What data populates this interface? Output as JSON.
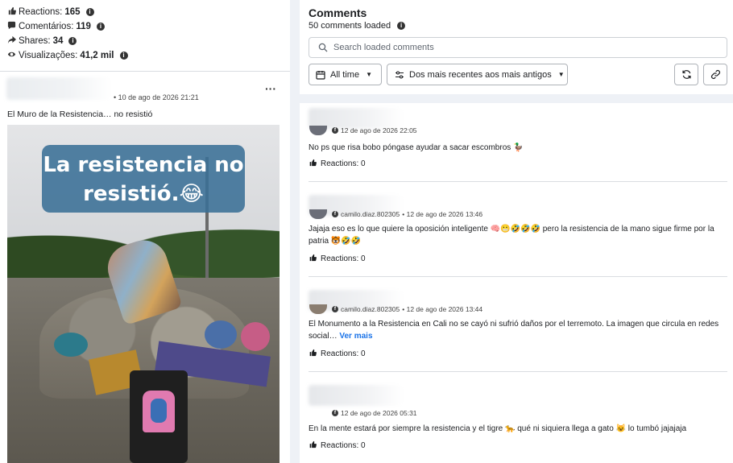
{
  "post_stats": {
    "reactions_label": "Reactions:",
    "reactions_value": "165",
    "comments_label": "Comentários:",
    "comments_value": "119",
    "shares_label": "Shares:",
    "shares_value": "34",
    "views_label": "Visualizações:",
    "views_value": "41,2 mil",
    "info_glyph": "i"
  },
  "post": {
    "date": "• 10 de ago de 2026 21:21",
    "text": "El Muro de la Resistencia… no resistió",
    "more_glyph": "···",
    "image_caption": "La resistencia no resistió.😂"
  },
  "comments_panel": {
    "title": "Comments",
    "loaded": "50 comments loaded",
    "search_placeholder": "Search loaded comments",
    "filter_label": "All time",
    "sort_label": "Dos mais recentes aos mais antigos",
    "caret": "▼",
    "info_glyph": "i"
  },
  "comments": [
    {
      "username": "",
      "date": "12 de ago de 2026 22:05",
      "text": "No ps que risa bobo póngase ayudar a sacar escombros 🦆",
      "more": "",
      "reactions": "Reactions: 0"
    },
    {
      "username": "camilo.diaz.802305",
      "date": "• 12 de ago de 2026 13:46",
      "text": "Jajaja eso es lo que quiere la oposición inteligente 🧠😬🤣🤣🤣 pero la resistencia de la mano sigue firme por la patria 🐯🤣🤣",
      "more": "",
      "reactions": "Reactions: 0"
    },
    {
      "username": "camilo.diaz.802305",
      "date": "• 12 de ago de 2026 13:44",
      "text": "El Monumento a la Resistencia en Cali no se cayó ni sufrió daños por el terremoto. La imagen que circula en redes social…",
      "more": "Ver mais",
      "reactions": "Reactions: 0"
    },
    {
      "username": "",
      "date": "12 de ago de 2026 05:31",
      "text": "En la mente estará por siempre la resistencia y el tigre 🐆 qué ni siquiera llega a gato 😺 lo tumbó jajajaja",
      "more": "",
      "reactions": "Reactions: 0"
    }
  ],
  "icons": {
    "reactions": "reactions-icon",
    "comments": "comment-bubble-icon",
    "shares": "share-arrow-icon",
    "views": "eye-icon",
    "search": "search-icon",
    "calendar": "calendar-icon",
    "sliders": "sliders-icon",
    "refresh": "refresh-icon",
    "link": "link-icon",
    "facebook": "facebook-icon"
  },
  "colors": {
    "panel_bg": "#eef1f6",
    "link": "#1a73e8",
    "caption_bg": "#3a7096"
  }
}
